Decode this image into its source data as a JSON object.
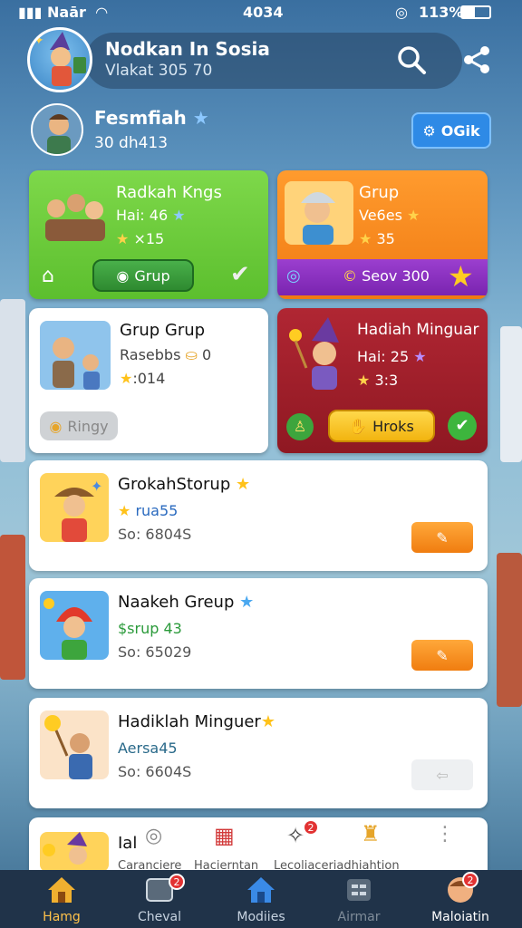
{
  "status": {
    "carrier": "Naār",
    "time": "4034",
    "battery": "113%"
  },
  "header": {
    "title": "Nodkan In Sosia",
    "subtitle": "Vlakat 305 70"
  },
  "profile": {
    "name": "Fesmfiah",
    "count": "30 dh413",
    "ok_label": "OGik"
  },
  "cards": {
    "c1": {
      "title": "Radkah Kngs",
      "line1": "Hai: 46",
      "line2": "×15",
      "button": "Grup"
    },
    "c2": {
      "title": "Grup",
      "line1": "Ve6es",
      "line2": "35",
      "bar": "Seov 300"
    },
    "c3": {
      "title": "Grup Grup",
      "line1": "Rasebbs",
      "line1_val": "0",
      "line2": ":014",
      "button": "Ringy"
    },
    "c4": {
      "title": "Hadiah Minguar",
      "line1": "Hai: 25",
      "line2": "3:3",
      "button": "Hroks"
    }
  },
  "rows": [
    {
      "title": "GrokahStorup",
      "sub": "rua55",
      "meta": "So: 6804S"
    },
    {
      "title": "Naakeh Greup",
      "sub": "$srup 43",
      "meta": "So: 65029"
    },
    {
      "title": "Hadiklah Minguer",
      "sub": "Aersa45",
      "meta": "So: 6604S"
    },
    {
      "title": "Ial",
      "sub": "Caranciere",
      "meta": ""
    }
  ],
  "row4_labels": {
    "a": "Hacierntan",
    "b": "Lecoliaceriadhiahtion"
  },
  "nav": [
    {
      "label": "Hamg",
      "badge": ""
    },
    {
      "label": "Cheval",
      "badge": "2"
    },
    {
      "label": "Modiies",
      "badge": ""
    },
    {
      "label": "Airmar",
      "badge": ""
    },
    {
      "label": "Maloiatin",
      "badge": "2"
    }
  ],
  "colors": {
    "green": "#6cc93c",
    "orange": "#f08a1f",
    "maroon": "#a11f2a",
    "blue": "#2e8ae6",
    "navbar": "#203349"
  }
}
